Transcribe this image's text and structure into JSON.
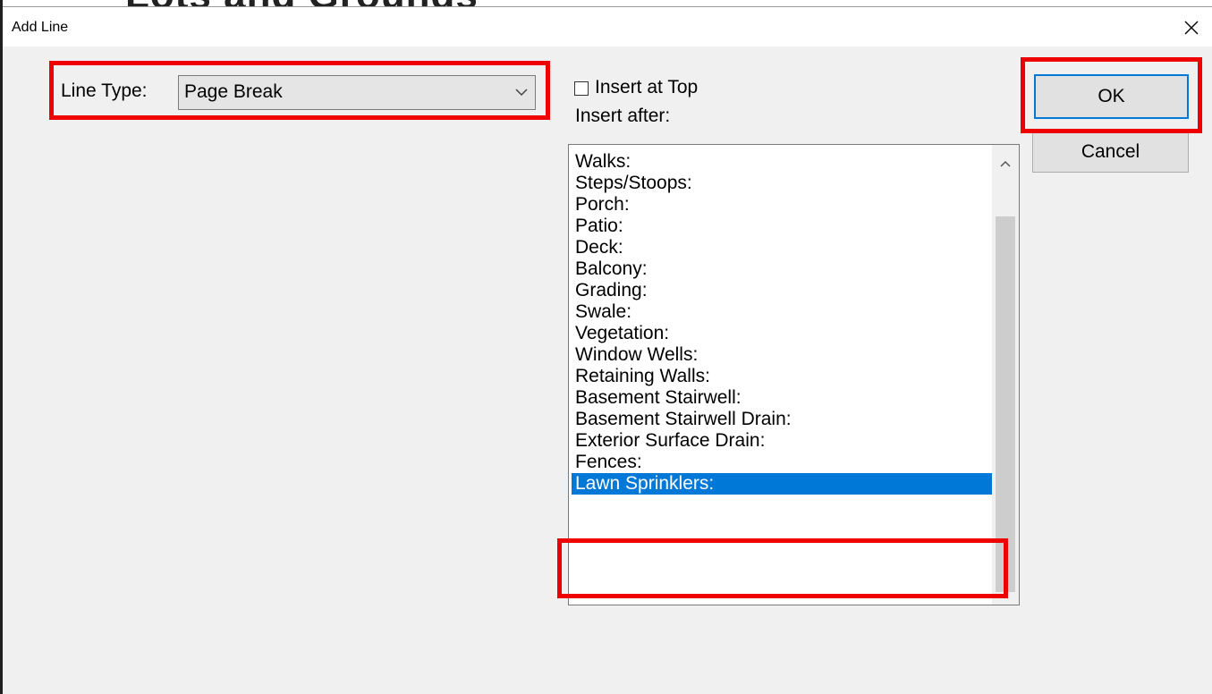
{
  "window": {
    "title": "Add Line",
    "background_text": "Lots and Grounds"
  },
  "line_type": {
    "label": "Line Type:",
    "selected_value": "Page Break"
  },
  "insert_at_top": {
    "label": "Insert at Top",
    "checked": false
  },
  "insert_after": {
    "label": "Insert after:",
    "items": [
      "Walks:",
      "Steps/Stoops:",
      "Porch:",
      "Patio:",
      "Deck:",
      "Balcony:",
      "Grading:",
      "Swale:",
      "Vegetation:",
      "Window Wells:",
      "Retaining Walls:",
      "Basement Stairwell:",
      "Basement Stairwell Drain:",
      "Exterior Surface Drain:",
      "Fences:",
      "Lawn Sprinklers:"
    ],
    "selected_item": "Lawn Sprinklers:"
  },
  "buttons": {
    "ok_label": "OK",
    "cancel_label": "Cancel"
  },
  "colors": {
    "highlight": "#ee0000",
    "selection": "#0078d7"
  }
}
